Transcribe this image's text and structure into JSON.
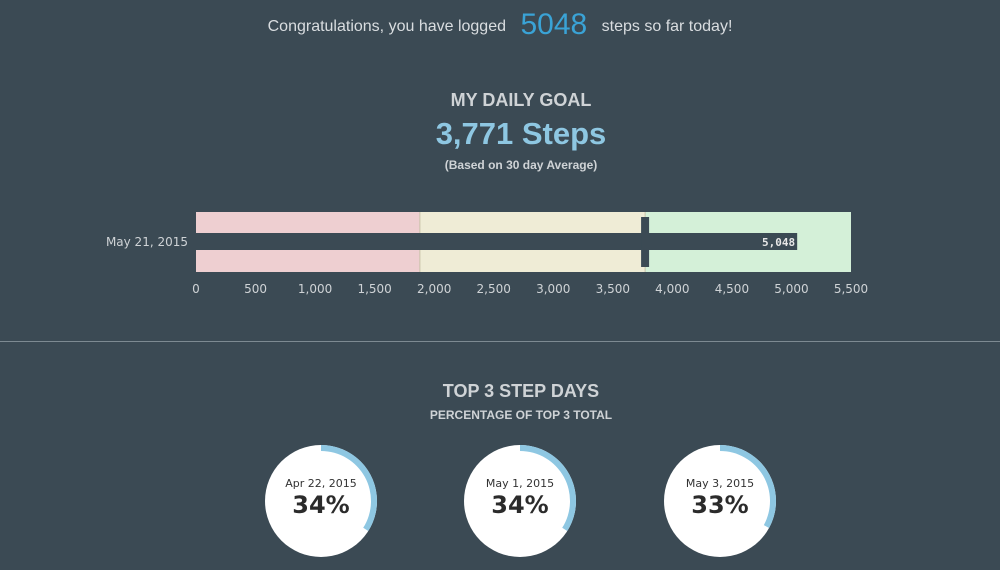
{
  "header": {
    "congrats_prefix": "Congratulations, you have logged",
    "steps_today": "5048",
    "congrats_suffix": "steps so far today!"
  },
  "goal": {
    "title": "MY DAILY GOAL",
    "value": "3,771 Steps",
    "note": "(Based on 30 day Average)"
  },
  "top3": {
    "title": "TOP 3 STEP DAYS",
    "subtitle": "PERCENTAGE OF TOP 3 TOTAL"
  },
  "chart_data": [
    {
      "type": "bullet",
      "category": "May 21, 2015",
      "ranges": [
        1880,
        3771,
        5500
      ],
      "measure": 5048,
      "measure_label": "5,048",
      "marker": 3771,
      "xlim": [
        0,
        5500
      ],
      "ticks": [
        0,
        500,
        1000,
        1500,
        2000,
        2500,
        3000,
        3500,
        4000,
        4500,
        5000,
        5500
      ],
      "tick_labels": [
        "0",
        "500",
        "1,000",
        "1,500",
        "2,000",
        "2,500",
        "3,000",
        "3,500",
        "4,000",
        "4,500",
        "5,000",
        "5,500"
      ],
      "colors": {
        "range_low": "#eecfd1",
        "range_mid": "#efecd6",
        "range_high": "#d4f0d8",
        "measure": "#3b4a54"
      }
    },
    {
      "type": "pie",
      "slices": [
        {
          "label": "Apr 22, 2015",
          "value": 34,
          "display": "34%"
        },
        {
          "label": "May 1, 2015",
          "value": 34,
          "display": "34%"
        },
        {
          "label": "May 3, 2015",
          "value": 33,
          "display": "33%"
        }
      ],
      "colors": {
        "arc": "#8ec7e2",
        "face": "#ffffff"
      }
    }
  ]
}
